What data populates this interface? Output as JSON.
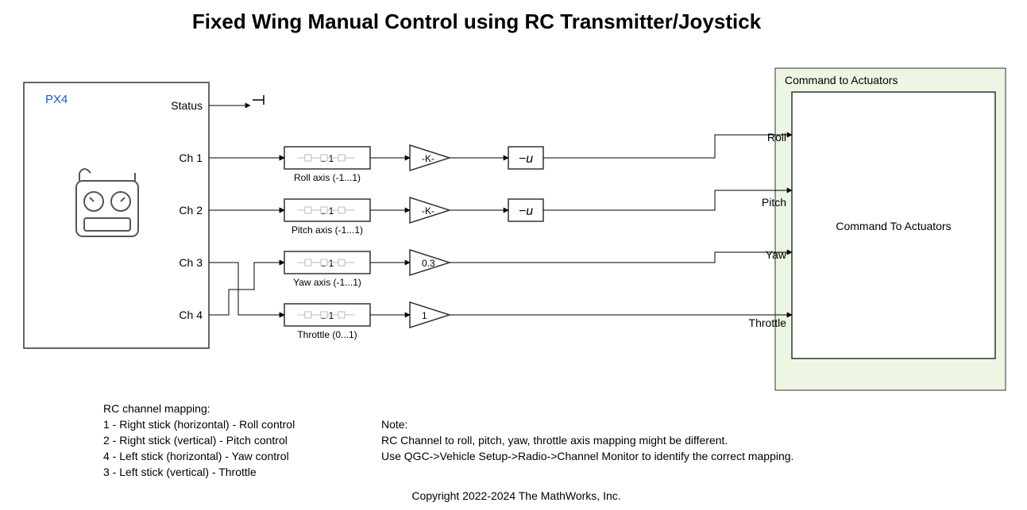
{
  "title": "Fixed Wing Manual Control using RC Transmitter/Joystick",
  "px4": {
    "label": "PX4"
  },
  "ports": {
    "status": "Status",
    "ch1": "Ch 1",
    "ch2": "Ch 2",
    "ch3": "Ch 3",
    "ch4": "Ch 4"
  },
  "scales": {
    "roll": {
      "range": "1           1",
      "caption": "Roll axis (-1...1)"
    },
    "pitch": {
      "range": "1           1",
      "caption": "Pitch axis (-1...1)"
    },
    "yaw": {
      "range": "1           1",
      "caption": "Yaw axis (-1...1)"
    },
    "thr": {
      "range": "1           1",
      "caption": "Throttle (0...1)"
    }
  },
  "gains": {
    "roll": "-K-",
    "pitch": "-K-",
    "yaw": "0.3",
    "thr": "1"
  },
  "negs": {
    "roll": "−u",
    "pitch": "−u"
  },
  "sink": {
    "areaTitle": "Command to Actuators",
    "blockTitle": "Command To Actuators",
    "in": {
      "roll": "Roll",
      "pitch": "Pitch",
      "yaw": "Yaw",
      "thr": "Throttle"
    }
  },
  "footer": {
    "map0": "RC channel mapping:",
    "map1": "1 - Right stick (horizontal) - Roll control",
    "map2": "2 - Right stick (vertical) - Pitch control",
    "map3": "4 - Left stick (horizontal) - Yaw control",
    "map4": "3 - Left stick (vertical) - Throttle",
    "note0": "Note:",
    "note1": "RC Channel to roll, pitch, yaw, throttle axis mapping might be different.",
    "note2": "Use QGC->Vehicle Setup->Radio->Channel Monitor to identify the correct mapping.",
    "copyright": "Copyright 2022-2024 The MathWorks, Inc."
  }
}
